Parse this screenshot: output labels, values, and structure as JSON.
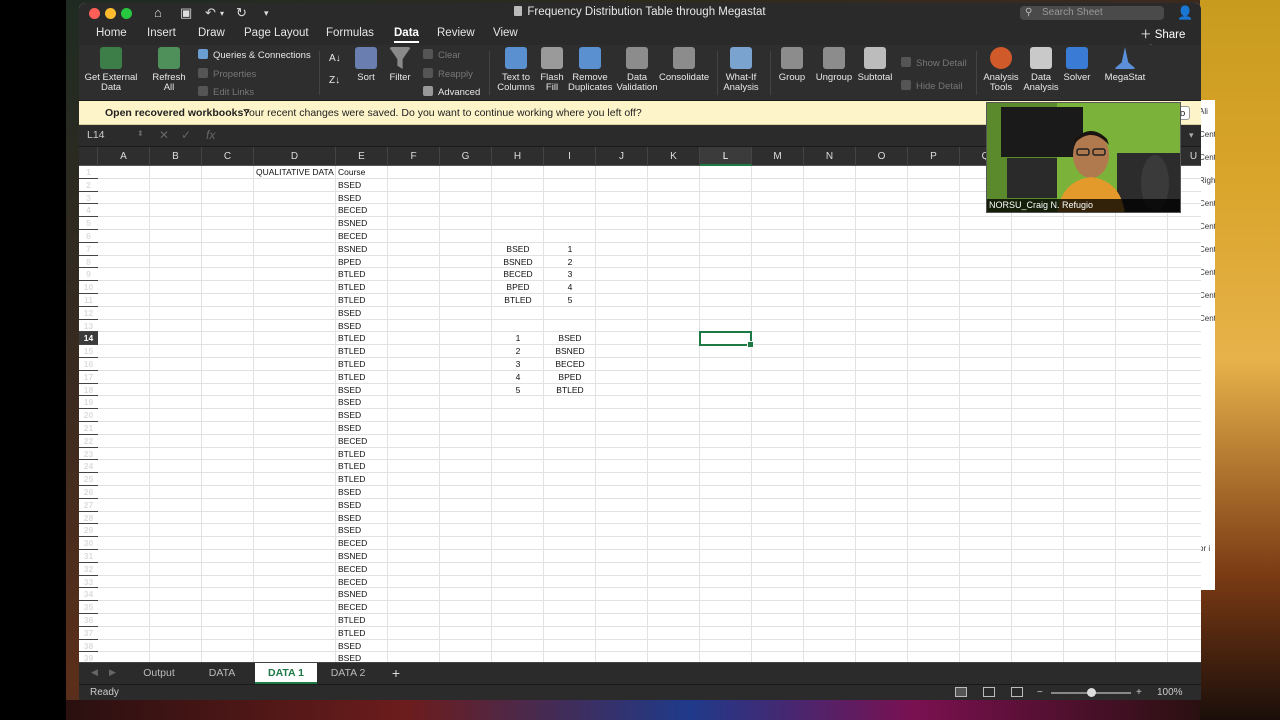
{
  "window": {
    "title": "Frequency Distribution Table through Megastat",
    "search_placeholder": "Search Sheet",
    "share_label": "Share"
  },
  "menu": {
    "items": [
      "Home",
      "Insert",
      "Draw",
      "Page Layout",
      "Formulas",
      "Data",
      "Review",
      "View"
    ],
    "active": "Data"
  },
  "ribbon": {
    "get_external": [
      "Get External",
      "Data"
    ],
    "refresh": [
      "Refresh",
      "All"
    ],
    "queries": "Queries & Connections",
    "properties": "Properties",
    "edit_links": "Edit Links",
    "sort": "Sort",
    "filter": "Filter",
    "clear": "Clear",
    "reapply": "Reapply",
    "advanced": "Advanced",
    "text_to_columns": [
      "Text to",
      "Columns"
    ],
    "flash_fill": [
      "Flash",
      "Fill"
    ],
    "remove_duplicates": [
      "Remove",
      "Duplicates"
    ],
    "data_validation": [
      "Data",
      "Validation"
    ],
    "consolidate": "Consolidate",
    "what_if": [
      "What-If",
      "Analysis"
    ],
    "group": "Group",
    "ungroup": "Ungroup",
    "subtotal": "Subtotal",
    "show_detail": "Show Detail",
    "hide_detail": "Hide Detail",
    "analysis_tools": [
      "Analysis",
      "Tools"
    ],
    "data_analysis": [
      "Data",
      "Analysis"
    ],
    "solver": "Solver",
    "megastat": "MegaStat"
  },
  "infobar": {
    "bold": "Open recovered workbooks?",
    "message": "Your recent changes were saved. Do you want to continue working where you left off?",
    "button": "o"
  },
  "formula": {
    "name_box": "L14",
    "fx": "fx",
    "cancel": "✕",
    "enter": "✓"
  },
  "columns": [
    "A",
    "B",
    "C",
    "D",
    "E",
    "F",
    "G",
    "H",
    "I",
    "J",
    "K",
    "L",
    "M",
    "N",
    "O",
    "P",
    "Q",
    "R",
    "S",
    "T",
    "U"
  ],
  "selected_column": "L",
  "selected_row": 14,
  "rows_visible": 39,
  "cells": {
    "D1": "QUALITATIVE DATA",
    "E": [
      "Course",
      "BSED",
      "BSED",
      "BECED",
      "BSNED",
      "BECED",
      "BSNED",
      "BPED",
      "BTLED",
      "BTLED",
      "BTLED",
      "BSED",
      "BSED",
      "BTLED",
      "BTLED",
      "BTLED",
      "BTLED",
      "BSED",
      "BSED",
      "BSED",
      "BSED",
      "BECED",
      "BTLED",
      "BTLED",
      "BTLED",
      "BSED",
      "BSED",
      "BSED",
      "BSED",
      "BECED",
      "BSNED",
      "BECED",
      "BECED",
      "BSNED",
      "BECED",
      "BTLED",
      "BTLED",
      "BSED",
      "BSED"
    ],
    "code_table": {
      "H": [
        "BSED",
        "BSNED",
        "BECED",
        "BPED",
        "BTLED"
      ],
      "I": [
        "1",
        "2",
        "3",
        "4",
        "5"
      ]
    },
    "reverse_table": {
      "H": [
        "1",
        "2",
        "3",
        "4",
        "5"
      ],
      "I": [
        "BSED",
        "BSNED",
        "BECED",
        "BPED",
        "BTLED"
      ]
    }
  },
  "sheet_tabs": [
    "Output",
    "DATA",
    "DATA 1",
    "DATA 2"
  ],
  "active_tab": "DATA 1",
  "add_sheet": "+",
  "status": {
    "ready": "Ready",
    "zoom": "100%",
    "zoom_level": 1.0
  },
  "webcam": {
    "name": "NORSU_Craig N. Refugio"
  },
  "side_peek": [
    "Ali",
    "Cent",
    "Cent",
    "Righ",
    "Cent",
    "Cent",
    "Cent",
    "Cent",
    "Cent",
    "Cent",
    "",
    "",
    "",
    "",
    "",
    "",
    "",
    "",
    "",
    "or i"
  ]
}
